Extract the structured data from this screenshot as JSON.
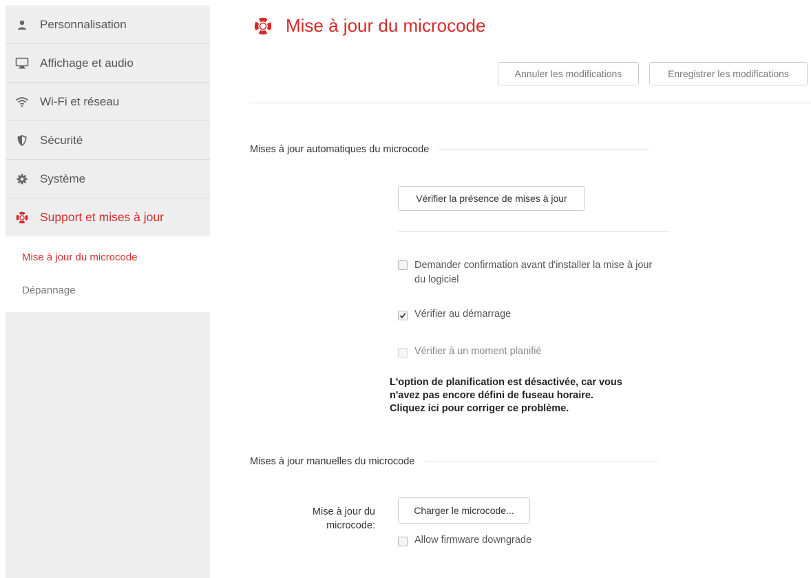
{
  "sidebar": {
    "items": [
      {
        "label": "Personnalisation",
        "icon": "user-icon"
      },
      {
        "label": "Affichage et audio",
        "icon": "monitor-icon"
      },
      {
        "label": "Wi-Fi et réseau",
        "icon": "wifi-icon"
      },
      {
        "label": "Sécurité",
        "icon": "shield-icon"
      },
      {
        "label": "Système",
        "icon": "gear-icon"
      },
      {
        "label": "Support et mises à jour",
        "icon": "lifebuoy-icon"
      }
    ],
    "subitems": [
      {
        "label": "Mise à jour du microcode"
      },
      {
        "label": "Dépannage"
      }
    ]
  },
  "page": {
    "title": "Mise à jour du microcode",
    "title_icon": "lifebuoy-icon",
    "cancel_label": "Annuler les modifications",
    "save_label": "Enregistrer les modifications"
  },
  "auto_section": {
    "title": "Mises à jour automatiques du microcode",
    "check_button": "Vérifier la présence de mises à jour",
    "options": [
      {
        "label": "Demander confirmation avant d'installer la mise à jour du logiciel",
        "checked": false
      },
      {
        "label": "Vérifier au démarrage",
        "checked": true
      },
      {
        "label": "Vérifier à un moment planifié",
        "checked": false,
        "disabled": true
      }
    ],
    "note_line1": "L'option de planification est désactivée, car vous",
    "note_line2": "n'avez pas encore défini de fuseau horaire.",
    "note_line3": "Cliquez ici pour corriger ce problème."
  },
  "manual_section": {
    "title": "Mises à jour manuelles du microcode",
    "field_label_line1": "Mise à jour du",
    "field_label_line2": "microcode:",
    "upload_button": "Charger le microcode...",
    "downgrade_label": "Allow firmware downgrade",
    "downgrade_checked": false
  },
  "colors": {
    "accent": "#d62a2a",
    "sidebar_bg": "#eeeeee"
  }
}
